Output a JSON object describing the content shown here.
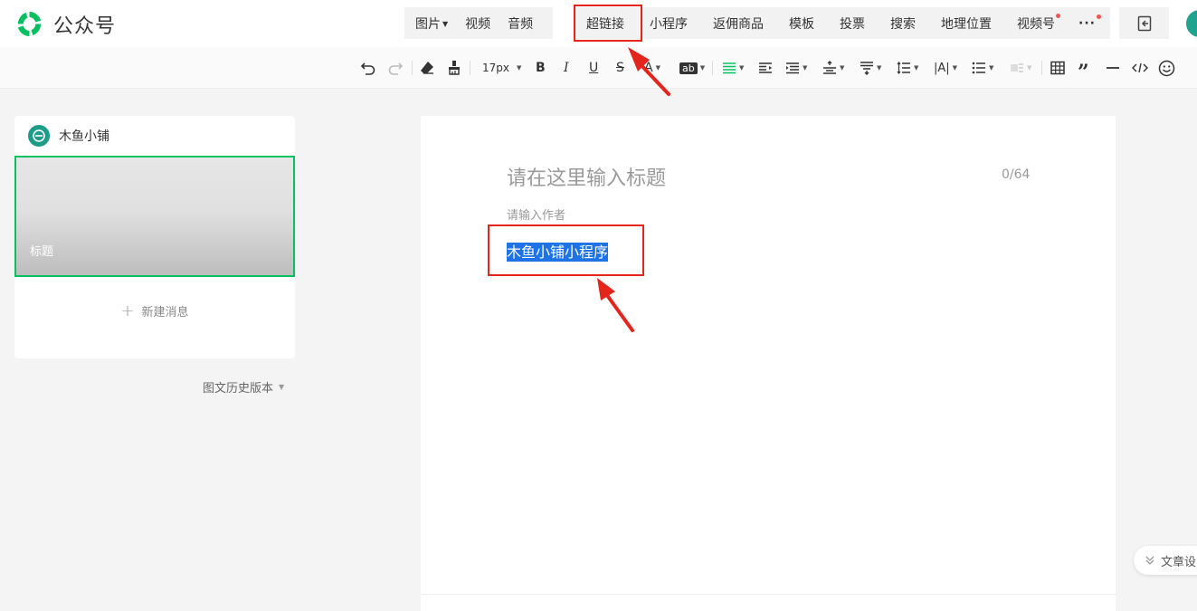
{
  "app": {
    "title": "公众号"
  },
  "insert_menu": {
    "items": [
      {
        "label": "图片",
        "dropdown": true
      },
      {
        "label": "视频"
      },
      {
        "label": "音频"
      },
      {
        "label": "超链接",
        "highlighted": true
      },
      {
        "label": "小程序"
      },
      {
        "label": "返佣商品"
      },
      {
        "label": "模板"
      },
      {
        "label": "投票"
      },
      {
        "label": "搜索"
      },
      {
        "label": "地理位置"
      },
      {
        "label": "视频号",
        "red_dot": true
      },
      {
        "label": "···",
        "red_dot": true
      }
    ]
  },
  "toolbar": {
    "font_size": "17px",
    "bold": "B",
    "italic": "I",
    "underline": "U",
    "strike": "S",
    "font_color": "A",
    "bg_color": "ab",
    "letter_spacing": "|A|"
  },
  "account": {
    "name": "木鱼小铺"
  },
  "article_card": {
    "cover_title": "标题"
  },
  "new_message": {
    "label": "新建消息"
  },
  "history_versions": {
    "label": "图文历史版本"
  },
  "editor": {
    "title_placeholder": "请在这里输入标题",
    "title_count": "0/64",
    "author_placeholder": "请输入作者",
    "body_selected_text": "木鱼小铺小程序"
  },
  "article_settings": {
    "label": "文章设"
  },
  "colors": {
    "brand_green": "#07c160",
    "selection_blue": "#1e73e8",
    "annotation_red": "#e4251b",
    "notice_red": "#fa5151"
  },
  "icons": [
    "logo-icon",
    "undo-icon",
    "redo-icon",
    "eraser-icon",
    "format-brush-icon",
    "align-icon",
    "indent-icon",
    "line-height-icon",
    "list-icon",
    "table-icon",
    "quote-icon",
    "divider-icon",
    "code-icon",
    "emoji-icon",
    "sidebar-toggle-icon",
    "chevron-double-down-icon"
  ]
}
